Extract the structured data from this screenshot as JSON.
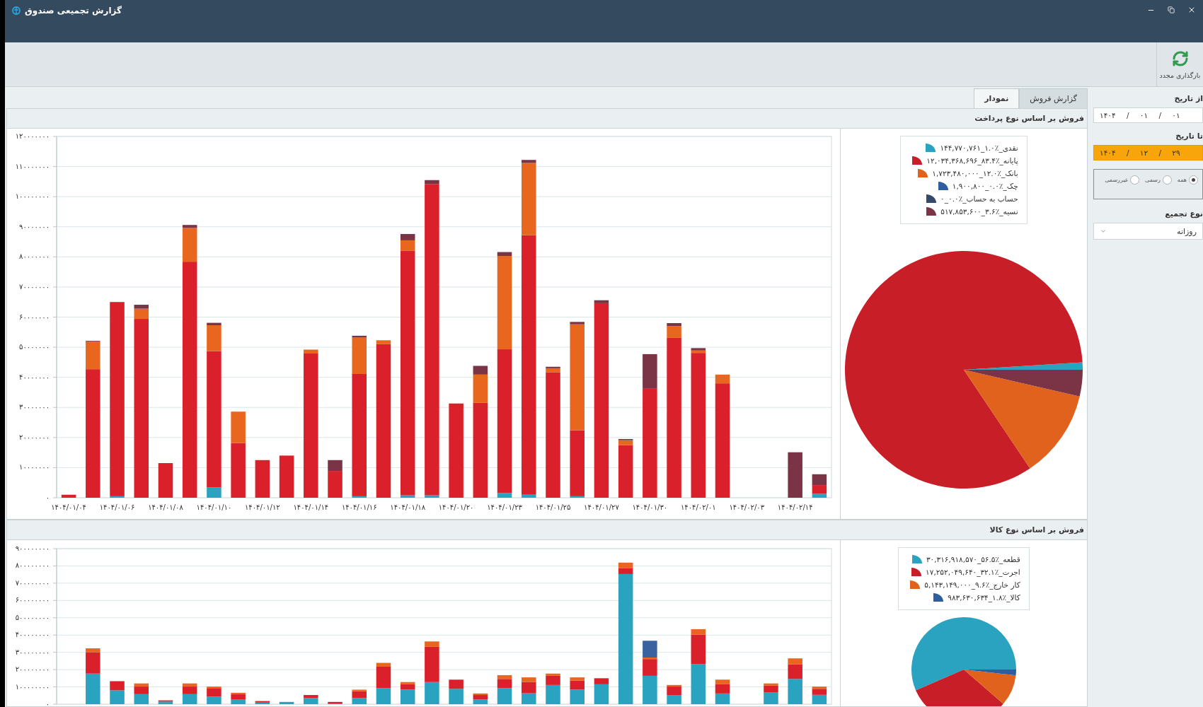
{
  "window": {
    "title": "گزارش تجمیعی صندوق"
  },
  "toolbar": {
    "buttons": [
      {
        "label": "بارگذاری مجدد"
      }
    ]
  },
  "tabs": [
    {
      "label": "گزارش فروش",
      "selected": false
    },
    {
      "label": "نمودار",
      "selected": true
    }
  ],
  "panels": [
    {
      "title": "فروش بر اساس نوع پرداخت",
      "bar_chart": {
        "chart_data": {
          "type": "bar",
          "stacked": true,
          "grid": true,
          "categories": [
            "۱۴۰۴/۰۱/۰۴",
            null,
            "۱۴۰۴/۰۱/۰۶",
            null,
            "۱۴۰۴/۰۱/۰۸",
            null,
            "۱۴۰۴/۰۱/۱۰",
            null,
            "۱۴۰۴/۰۱/۱۲",
            null,
            "۱۴۰۴/۰۱/۱۴",
            null,
            "۱۴۰۴/۰۱/۱۶",
            null,
            "۱۴۰۴/۰۱/۱۸",
            null,
            "۱۴۰۴/۰۱/۲۰",
            null,
            "۱۴۰۴/۰۱/۲۳",
            null,
            "۱۴۰۴/۰۱/۲۵",
            null,
            "۱۴۰۴/۰۱/۲۷",
            null,
            "۱۴۰۴/۰۱/۳۰",
            null,
            "۱۴۰۴/۰۲/۰۱",
            null,
            "۱۴۰۴/۰۲/۰۳",
            null,
            "۱۴۰۴/۰۲/۱۴",
            null
          ],
          "ylim": [
            0,
            120000000
          ],
          "yticks": [
            {
              "value": 0,
              "label": "۰"
            },
            {
              "value": 10000000,
              "label": "۱۰۰۰۰۰۰۰"
            },
            {
              "value": 20000000,
              "label": "۲۰۰۰۰۰۰۰"
            },
            {
              "value": 30000000,
              "label": "۳۰۰۰۰۰۰۰"
            },
            {
              "value": 40000000,
              "label": "۴۰۰۰۰۰۰۰"
            },
            {
              "value": 50000000,
              "label": "۵۰۰۰۰۰۰۰"
            },
            {
              "value": 60000000,
              "label": "۶۰۰۰۰۰۰۰"
            },
            {
              "value": 70000000,
              "label": "۷۰۰۰۰۰۰۰"
            },
            {
              "value": 80000000,
              "label": "۸۰۰۰۰۰۰۰"
            },
            {
              "value": 90000000,
              "label": "۹۰۰۰۰۰۰۰"
            },
            {
              "value": 100000000,
              "label": "۱۰۰۰۰۰۰۰۰"
            },
            {
              "value": 110000000,
              "label": "۱۱۰۰۰۰۰۰۰"
            },
            {
              "value": 120000000,
              "label": "۱۲۰۰۰۰۰۰۰"
            }
          ],
          "series": [
            {
              "color": "#2aa3c0",
              "values": [
                0,
                0,
                500000,
                0,
                0,
                0,
                3400000,
                0,
                0,
                0,
                0,
                0,
                500000,
                0,
                800000,
                800000,
                0,
                0,
                1600000,
                1000000,
                0,
                500000,
                0,
                0,
                0,
                0,
                0,
                0,
                0,
                0,
                0,
                1300000
              ]
            },
            {
              "color": "#d9202b",
              "values": [
                1000000,
                42700000,
                64500000,
                59400000,
                11500000,
                78400000,
                45300000,
                18200000,
                12500000,
                14000000,
                47900000,
                8900000,
                40600000,
                51000000,
                81300000,
                103400000,
                31300000,
                31500000,
                47700000,
                86200000,
                41700000,
                21900000,
                64600000,
                17500000,
                36200000,
                53100000,
                48100000,
                38000000,
                0,
                0,
                0,
                2900000
              ]
            },
            {
              "color": "#e8661e",
              "values": [
                0,
                9100000,
                0,
                3400000,
                0,
                11200000,
                8600000,
                10400000,
                0,
                0,
                1300000,
                0,
                12200000,
                1300000,
                3400000,
                0,
                0,
                9400000,
                31000000,
                24000000,
                1300000,
                35200000,
                0,
                1600000,
                0,
                3900000,
                800000,
                2900000,
                0,
                0,
                0,
                0
              ]
            },
            {
              "color": "#7b3346",
              "values": [
                0,
                300000,
                0,
                1300000,
                0,
                1000000,
                800000,
                0,
                0,
                0,
                0,
                3600000,
                500000,
                0,
                2100000,
                1300000,
                0,
                2900000,
                1300000,
                1000000,
                500000,
                800000,
                1000000,
                400000,
                11500000,
                1000000,
                800000,
                0,
                0,
                0,
                15100000,
                3600000
              ]
            }
          ]
        }
      },
      "pie_chart": {
        "legend": [
          {
            "label": "نقدی_٪۱.۰_۱۴۴,۷۷۰,۷۶۱",
            "color": "#2aa3c0"
          },
          {
            "label": "پایانه_٪۸۳.۴_۱۲,۰۳۴,۳۶۸,۶۹۶",
            "color": "#c81e28"
          },
          {
            "label": "بانک_٪۱۲.۰_۱,۷۲۳,۴۸۰,۰۰۰",
            "color": "#e0621c"
          },
          {
            "label": "چک_٪۰.۰_۱,۹۰۰,۸۰۰",
            "color": "#2f5d9e"
          },
          {
            "label": "حساب به حساب_٪۰.۰_۰",
            "color": "#354a6b"
          },
          {
            "label": "نسیه_٪۳.۶_۵۱۷,۸۵۳,۶۰۰",
            "color": "#7b3346"
          }
        ],
        "chart_data": {
          "type": "pie",
          "values": [
            1.0,
            83.4,
            12.0,
            0.0,
            0.0,
            3.6
          ]
        }
      }
    },
    {
      "title": "فروش بر اساس نوع کالا",
      "bar_chart": {
        "chart_data": {
          "type": "bar",
          "stacked": true,
          "grid": true,
          "ylim": [
            0,
            900000000
          ],
          "yticks": [
            {
              "value": 0,
              "label": "۰"
            },
            {
              "value": 100000000,
              "label": "۱۰۰۰۰۰۰۰۰"
            },
            {
              "value": 200000000,
              "label": "۲۰۰۰۰۰۰۰۰"
            },
            {
              "value": 300000000,
              "label": "۳۰۰۰۰۰۰۰۰"
            },
            {
              "value": 400000000,
              "label": "۴۰۰۰۰۰۰۰۰"
            },
            {
              "value": 500000000,
              "label": "۵۰۰۰۰۰۰۰۰"
            },
            {
              "value": 600000000,
              "label": "۶۰۰۰۰۰۰۰۰"
            },
            {
              "value": 700000000,
              "label": "۷۰۰۰۰۰۰۰۰"
            },
            {
              "value": 800000000,
              "label": "۸۰۰۰۰۰۰۰۰"
            },
            {
              "value": 900000000,
              "label": "۹۰۰۰۰۰۰۰۰"
            }
          ],
          "series": [
            {
              "color": "#2aa3c0",
              "values": [
                0,
                177000000,
                80000000,
                58000000,
                15000000,
                58000000,
                44000000,
                26000000,
                9000000,
                13000000,
                35000000,
                4000000,
                35000000,
                93000000,
                84000000,
                128000000,
                89000000,
                27000000,
                93000000,
                63000000,
                111000000,
                84000000,
                115000000,
                753000000,
                164000000,
                53000000,
                231000000,
                62000000,
                0,
                67000000,
                146000000,
                54000000
              ]
            },
            {
              "color": "#d9202b",
              "values": [
                0,
                124000000,
                53000000,
                44000000,
                7000000,
                44000000,
                49000000,
                31000000,
                9000000,
                0,
                18000000,
                9000000,
                40000000,
                124000000,
                31000000,
                204000000,
                53000000,
                26000000,
                53000000,
                66000000,
                53000000,
                53000000,
                35000000,
                35000000,
                97000000,
                49000000,
                172000000,
                53000000,
                0,
                40000000,
                84000000,
                35000000
              ]
            },
            {
              "color": "#e8661e",
              "values": [
                null,
                22000000,
                0,
                18000000,
                0,
                18000000,
                9000000,
                9000000,
                0,
                0,
                0,
                0,
                9000000,
                22000000,
                13000000,
                31000000,
                0,
                9000000,
                22000000,
                26000000,
                13000000,
                18000000,
                0,
                31000000,
                9000000,
                9000000,
                31000000,
                27000000,
                0,
                13000000,
                35000000,
                13000000
              ]
            },
            {
              "color": "#3b62a0",
              "values": [
                0,
                0,
                0,
                0,
                0,
                0,
                0,
                0,
                0,
                0,
                0,
                0,
                0,
                0,
                0,
                0,
                0,
                0,
                0,
                0,
                0,
                0,
                0,
                0,
                97000000,
                0,
                0,
                0,
                0,
                0,
                0,
                0
              ]
            }
          ]
        }
      },
      "pie_chart": {
        "legend": [
          {
            "label": "قطعه_٪۵۶.۵_۳۰,۳۱۶,۹۱۸,۵۷۰",
            "color": "#2aa3c0"
          },
          {
            "label": "اجرت_٪۳۲.۱_۱۷,۲۵۲,۰۴۹,۶۴۰",
            "color": "#c81e28"
          },
          {
            "label": "کار خارج_٪۹.۶_۵,۱۴۳,۱۴۹,۰۰۰",
            "color": "#e0621c"
          },
          {
            "label": "کالا_٪۱.۸_۹۸۳,۶۳۰,۶۳۴",
            "color": "#2f5d9e"
          }
        ],
        "chart_data": {
          "type": "pie",
          "values": [
            56.5,
            32.1,
            9.6,
            1.8
          ]
        }
      }
    }
  ],
  "filters": {
    "from_label": "از تاریخ",
    "from_date": {
      "value": "۱۴۰۴ / ۰۱ / ۰۱",
      "highlighted": false
    },
    "to_label": "تا تاریخ",
    "to_date": {
      "value": "۱۴۰۴ / ۱۲ / ۲۹",
      "highlighted": true
    },
    "radios": [
      {
        "label": "همه",
        "selected": true
      },
      {
        "label": "رسمی",
        "selected": false
      },
      {
        "label": "غیررسمی",
        "selected": false
      }
    ],
    "aggregation_label": "نوع تجمیع",
    "aggregation": {
      "value": "روزانه"
    }
  }
}
